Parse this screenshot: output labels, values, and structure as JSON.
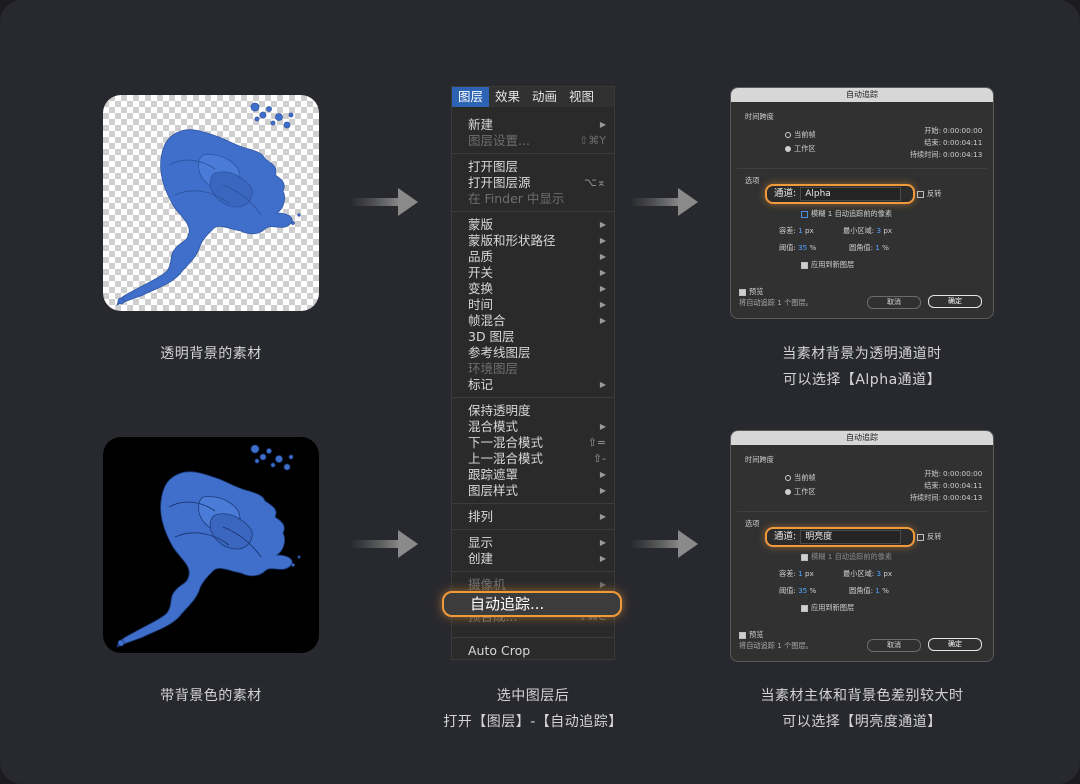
{
  "captions": {
    "transparent_asset": "透明背景的素材",
    "bg_asset": "带背景色的素材",
    "menu_step_line1": "选中图层后",
    "menu_step_line2": "打开【图层】-【自动追踪】",
    "alpha_line1": "当素材背景为透明通道时",
    "alpha_line2": "可以选择【Alpha通道】",
    "lum_line1": "当素材主体和背景色差别较大时",
    "lum_line2": "可以选择【明亮度通道】"
  },
  "menu": {
    "tabs": [
      "图层",
      "效果",
      "动画",
      "视图"
    ],
    "items": [
      {
        "label": "新建",
        "shortcut": "",
        "disabled": false,
        "submenu": true
      },
      {
        "label": "图层设置...",
        "shortcut": "⇧⌘Y",
        "disabled": true,
        "submenu": false
      },
      {
        "label": "打开图层",
        "shortcut": "",
        "disabled": false,
        "submenu": false
      },
      {
        "label": "打开图层源",
        "shortcut": "⌥⌅",
        "disabled": false,
        "submenu": false
      },
      {
        "label": "在 Finder 中显示",
        "shortcut": "",
        "disabled": true,
        "submenu": false
      },
      {
        "label": "蒙版",
        "shortcut": "",
        "disabled": false,
        "submenu": true
      },
      {
        "label": "蒙版和形状路径",
        "shortcut": "",
        "disabled": false,
        "submenu": true
      },
      {
        "label": "品质",
        "shortcut": "",
        "disabled": false,
        "submenu": true
      },
      {
        "label": "开关",
        "shortcut": "",
        "disabled": false,
        "submenu": true
      },
      {
        "label": "变换",
        "shortcut": "",
        "disabled": false,
        "submenu": true
      },
      {
        "label": "时间",
        "shortcut": "",
        "disabled": false,
        "submenu": true
      },
      {
        "label": "帧混合",
        "shortcut": "",
        "disabled": false,
        "submenu": true
      },
      {
        "label": "3D 图层",
        "shortcut": "",
        "disabled": false,
        "submenu": false
      },
      {
        "label": "参考线图层",
        "shortcut": "",
        "disabled": false,
        "submenu": false
      },
      {
        "label": "环境图层",
        "shortcut": "",
        "disabled": true,
        "submenu": false
      },
      {
        "label": "标记",
        "shortcut": "",
        "disabled": false,
        "submenu": true
      },
      {
        "label": "保持透明度",
        "shortcut": "",
        "disabled": false,
        "submenu": false
      },
      {
        "label": "混合模式",
        "shortcut": "",
        "disabled": false,
        "submenu": true
      },
      {
        "label": "下一混合模式",
        "shortcut": "⇧=",
        "disabled": false,
        "submenu": false
      },
      {
        "label": "上一混合模式",
        "shortcut": "⇧-",
        "disabled": false,
        "submenu": false
      },
      {
        "label": "跟踪遮罩",
        "shortcut": "",
        "disabled": false,
        "submenu": true
      },
      {
        "label": "图层样式",
        "shortcut": "",
        "disabled": false,
        "submenu": true
      },
      {
        "label": "排列",
        "shortcut": "",
        "disabled": false,
        "submenu": true
      },
      {
        "label": "显示",
        "shortcut": "",
        "disabled": false,
        "submenu": true
      },
      {
        "label": "创建",
        "shortcut": "",
        "disabled": false,
        "submenu": true
      },
      {
        "label": "摄像机",
        "shortcut": "",
        "disabled": true,
        "submenu": true
      },
      {
        "label": "预合成...",
        "shortcut": "⇧⌘C",
        "disabled": true,
        "submenu": false
      },
      {
        "label": "Auto Crop",
        "shortcut": "",
        "disabled": false,
        "submenu": false
      }
    ],
    "highlighted": "自动追踪..."
  },
  "dialog_common": {
    "title": "自动追踪",
    "time_span": "时间跨度",
    "current_frame": "当前帧",
    "work_area": "工作区",
    "start_label": "开始:",
    "start_value": "0:00:00:00",
    "end_label": "结束:",
    "end_value": "0:00:04:11",
    "duration_label": "持续时间:",
    "duration_value": "0:00:04:13",
    "options": "选项",
    "channel_label": "通道:",
    "invert": "反转",
    "blur_before": "模糊",
    "blur_value": "1",
    "blur_after": "自动追踪前的像素",
    "tolerance_label": "容差:",
    "tolerance_value": "1",
    "tolerance_unit": "px",
    "min_area_label": "最小区域:",
    "min_area_value": "3",
    "min_area_unit": "px",
    "threshold_label": "阈值:",
    "threshold_value": "35",
    "threshold_unit": "%",
    "corner_label": "圆角值:",
    "corner_value": "1",
    "corner_unit": "%",
    "apply_new_layer": "应用到新图层",
    "preview": "预览",
    "status": "将自动追踪 1 个图层。",
    "cancel": "取消",
    "ok": "确定"
  },
  "dialog_alpha": {
    "channel_value": "Alpha"
  },
  "dialog_luminance": {
    "channel_value": "明亮度"
  },
  "colors": {
    "accent_orange": "#f19a3c",
    "menu_active": "#2c63b3",
    "flower_blue": "#3f6fcb"
  }
}
